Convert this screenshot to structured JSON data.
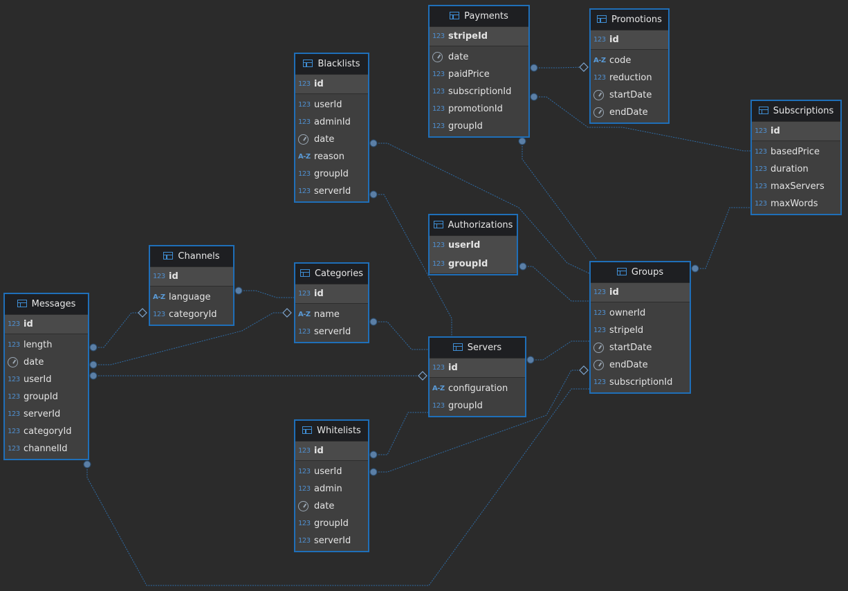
{
  "diagram": {
    "entities": [
      {
        "key": "payments",
        "name": "Payments",
        "pk": [
          {
            "name": "stripeId",
            "type": "num"
          }
        ],
        "columns": [
          {
            "name": "date",
            "type": "date"
          },
          {
            "name": "paidPrice",
            "type": "num"
          },
          {
            "name": "subscriptionId",
            "type": "num"
          },
          {
            "name": "promotionId",
            "type": "num"
          },
          {
            "name": "groupId",
            "type": "num"
          }
        ]
      },
      {
        "key": "promotions",
        "name": "Promotions",
        "pk": [
          {
            "name": "id",
            "type": "num"
          }
        ],
        "columns": [
          {
            "name": "code",
            "type": "str"
          },
          {
            "name": "reduction",
            "type": "num"
          },
          {
            "name": "startDate",
            "type": "date"
          },
          {
            "name": "endDate",
            "type": "date"
          }
        ]
      },
      {
        "key": "subscriptions",
        "name": "Subscriptions",
        "pk": [
          {
            "name": "id",
            "type": "num"
          }
        ],
        "columns": [
          {
            "name": "basedPrice",
            "type": "num"
          },
          {
            "name": "duration",
            "type": "num"
          },
          {
            "name": "maxServers",
            "type": "num"
          },
          {
            "name": "maxWords",
            "type": "num"
          }
        ]
      },
      {
        "key": "blacklists",
        "name": "Blacklists",
        "pk": [
          {
            "name": "id",
            "type": "num"
          }
        ],
        "columns": [
          {
            "name": "userId",
            "type": "num"
          },
          {
            "name": "adminId",
            "type": "num"
          },
          {
            "name": "date",
            "type": "date"
          },
          {
            "name": "reason",
            "type": "str"
          },
          {
            "name": "groupId",
            "type": "num"
          },
          {
            "name": "serverId",
            "type": "num"
          }
        ]
      },
      {
        "key": "authorizations",
        "name": "Authorizations",
        "pk": [
          {
            "name": "userId",
            "type": "num"
          },
          {
            "name": "groupId",
            "type": "num"
          }
        ],
        "columns": []
      },
      {
        "key": "channels",
        "name": "Channels",
        "pk": [
          {
            "name": "id",
            "type": "num"
          }
        ],
        "columns": [
          {
            "name": "language",
            "type": "str"
          },
          {
            "name": "categoryId",
            "type": "num"
          }
        ]
      },
      {
        "key": "categories",
        "name": "Categories",
        "pk": [
          {
            "name": "id",
            "type": "num"
          }
        ],
        "columns": [
          {
            "name": "name",
            "type": "str"
          },
          {
            "name": "serverId",
            "type": "num"
          }
        ]
      },
      {
        "key": "groups",
        "name": "Groups",
        "pk": [
          {
            "name": "id",
            "type": "num"
          }
        ],
        "columns": [
          {
            "name": "ownerId",
            "type": "num"
          },
          {
            "name": "stripeId",
            "type": "num"
          },
          {
            "name": "startDate",
            "type": "date"
          },
          {
            "name": "endDate",
            "type": "date"
          },
          {
            "name": "subscriptionId",
            "type": "num"
          }
        ]
      },
      {
        "key": "messages",
        "name": "Messages",
        "pk": [
          {
            "name": "id",
            "type": "num"
          }
        ],
        "columns": [
          {
            "name": "length",
            "type": "num"
          },
          {
            "name": "date",
            "type": "date"
          },
          {
            "name": "userId",
            "type": "num"
          },
          {
            "name": "groupId",
            "type": "num"
          },
          {
            "name": "serverId",
            "type": "num"
          },
          {
            "name": "categoryId",
            "type": "num"
          },
          {
            "name": "channelId",
            "type": "num"
          }
        ]
      },
      {
        "key": "servers",
        "name": "Servers",
        "pk": [
          {
            "name": "id",
            "type": "num"
          }
        ],
        "columns": [
          {
            "name": "configuration",
            "type": "str"
          },
          {
            "name": "groupId",
            "type": "num"
          }
        ]
      },
      {
        "key": "whitelists",
        "name": "Whitelists",
        "pk": [
          {
            "name": "id",
            "type": "num"
          }
        ],
        "columns": [
          {
            "name": "userId",
            "type": "num"
          },
          {
            "name": "admin",
            "type": "num"
          },
          {
            "name": "date",
            "type": "date"
          },
          {
            "name": "groupId",
            "type": "num"
          },
          {
            "name": "serverId",
            "type": "num"
          }
        ]
      }
    ],
    "type_icons": {
      "num": "123",
      "str": "A-Z",
      "date": "clock-icon"
    },
    "colors": {
      "background": "#2b2b2b",
      "border": "#1f6fb9",
      "header": "#1e1f22",
      "body": "#3f3f3f",
      "pk_band": "#4a4a4a",
      "link": "#2f6da8",
      "endpoint": "#5b7fa6"
    }
  }
}
